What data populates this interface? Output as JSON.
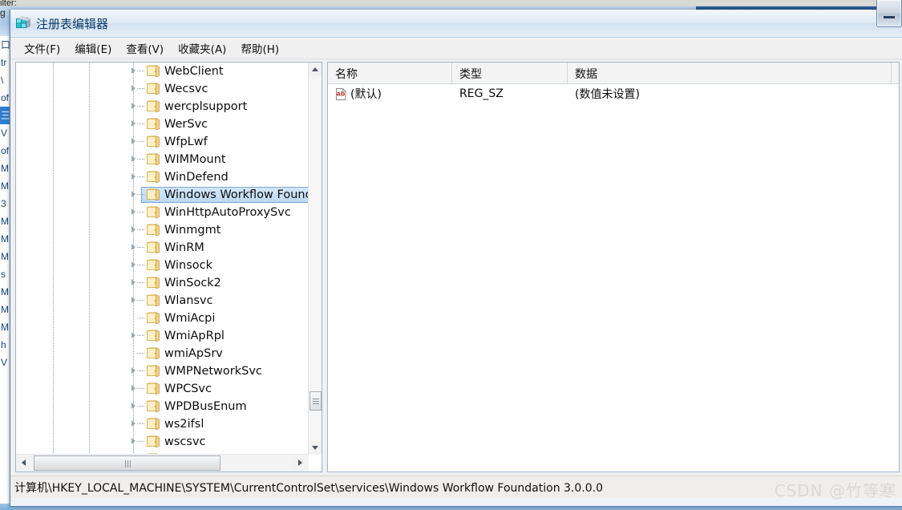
{
  "window": {
    "title": "注册表编辑器",
    "icon": "registry-editor-icon",
    "minimize_label": "最小化"
  },
  "menubar": {
    "items": [
      {
        "label": "文件(F)"
      },
      {
        "label": "编辑(E)"
      },
      {
        "label": "查看(V)"
      },
      {
        "label": "收藏夹(A)"
      },
      {
        "label": "帮助(H)"
      }
    ]
  },
  "tree": {
    "items": [
      {
        "label": "WebClient",
        "expandable": true,
        "selected": false
      },
      {
        "label": "Wecsvc",
        "expandable": true,
        "selected": false
      },
      {
        "label": "wercplsupport",
        "expandable": true,
        "selected": false
      },
      {
        "label": "WerSvc",
        "expandable": true,
        "selected": false
      },
      {
        "label": "WfpLwf",
        "expandable": true,
        "selected": false
      },
      {
        "label": "WIMMount",
        "expandable": true,
        "selected": false
      },
      {
        "label": "WinDefend",
        "expandable": true,
        "selected": false
      },
      {
        "label": "Windows Workflow Founda",
        "expandable": true,
        "selected": true
      },
      {
        "label": "WinHttpAutoProxySvc",
        "expandable": true,
        "selected": false
      },
      {
        "label": "Winmgmt",
        "expandable": true,
        "selected": false
      },
      {
        "label": "WinRM",
        "expandable": true,
        "selected": false
      },
      {
        "label": "Winsock",
        "expandable": true,
        "selected": false
      },
      {
        "label": "WinSock2",
        "expandable": true,
        "selected": false
      },
      {
        "label": "Wlansvc",
        "expandable": true,
        "selected": false
      },
      {
        "label": "WmiAcpi",
        "expandable": false,
        "selected": false
      },
      {
        "label": "WmiApRpl",
        "expandable": true,
        "selected": false
      },
      {
        "label": "wmiApSrv",
        "expandable": false,
        "selected": false
      },
      {
        "label": "WMPNetworkSvc",
        "expandable": true,
        "selected": false
      },
      {
        "label": "WPCSvc",
        "expandable": true,
        "selected": false
      },
      {
        "label": "WPDBusEnum",
        "expandable": true,
        "selected": false
      },
      {
        "label": "ws2ifsl",
        "expandable": true,
        "selected": false
      },
      {
        "label": "wscsvc",
        "expandable": true,
        "selected": false
      },
      {
        "label": "WSearch",
        "expandable": false,
        "selected": false
      }
    ]
  },
  "values": {
    "columns": [
      {
        "label": "名称"
      },
      {
        "label": "类型"
      },
      {
        "label": "数据"
      }
    ],
    "rows": [
      {
        "icon": "string-value-icon",
        "name": "(默认)",
        "type": "REG_SZ",
        "data": "(数值未设置)"
      }
    ]
  },
  "statusbar": {
    "path": "计算机\\HKEY_LOCAL_MACHINE\\SYSTEM\\CurrentControlSet\\services\\Windows Workflow Foundation 3.0.0.0",
    "watermark": "CSDN @竹等寒"
  },
  "background": {
    "top_fragment": "ilter:",
    "left_fragment": "g",
    "list_fragments": [
      "",
      "",
      "",
      "口",
      "tr",
      "\\",
      "of",
      "三",
      "V",
      "of",
      "M",
      "M",
      "3",
      "M",
      "M",
      "M",
      "s",
      "M",
      "M",
      "M",
      "h",
      "",
      "",
      "V"
    ],
    "selected_index": 7
  },
  "colors": {
    "selection_border": "#7da7d0",
    "folder": "#f5d98a",
    "title_text": "#0b3a66",
    "value_icon_text": "#c0392b"
  }
}
